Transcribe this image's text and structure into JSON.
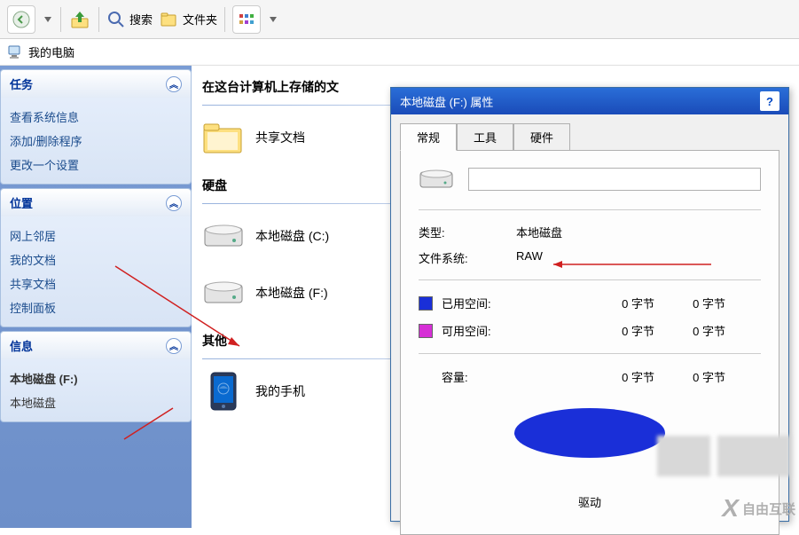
{
  "toolbar": {
    "search_label": "搜索",
    "folders_label": "文件夹"
  },
  "title": "我的电脑",
  "sidebar": {
    "panels": [
      {
        "title": "任务",
        "items": [
          "查看系统信息",
          "添加/删除程序",
          "更改一个设置"
        ]
      },
      {
        "title": "位置",
        "items": [
          "网上邻居",
          "我的文档",
          "共享文档",
          "控制面板"
        ]
      },
      {
        "title": "信息",
        "items": [
          "本地磁盘 (F:)",
          "本地磁盘"
        ]
      }
    ]
  },
  "content": {
    "header": "在这台计算机上存储的文",
    "sections": [
      {
        "title": "",
        "items": [
          {
            "label": "共享文档",
            "icon": "folder"
          }
        ]
      },
      {
        "title": "硬盘",
        "items": [
          {
            "label": "本地磁盘 (C:)",
            "icon": "drive"
          },
          {
            "label": "本地磁盘 (F:)",
            "icon": "drive"
          }
        ]
      },
      {
        "title": "其他",
        "items": [
          {
            "label": "我的手机",
            "icon": "phone"
          }
        ]
      }
    ]
  },
  "dialog": {
    "title": "本地磁盘 (F:) 属性",
    "tabs": [
      "常规",
      "工具",
      "硬件"
    ],
    "active_tab": 0,
    "type_label": "类型:",
    "type_value": "本地磁盘",
    "fs_label": "文件系统:",
    "fs_value": "RAW",
    "used_label": "已用空间:",
    "free_label": "可用空间:",
    "capacity_label": "容量:",
    "bytes0": "0 字节",
    "drive_letter": "驱动",
    "colors": {
      "used": "#1a2fd8",
      "free": "#d62fd6"
    }
  },
  "watermark": "自由互联"
}
